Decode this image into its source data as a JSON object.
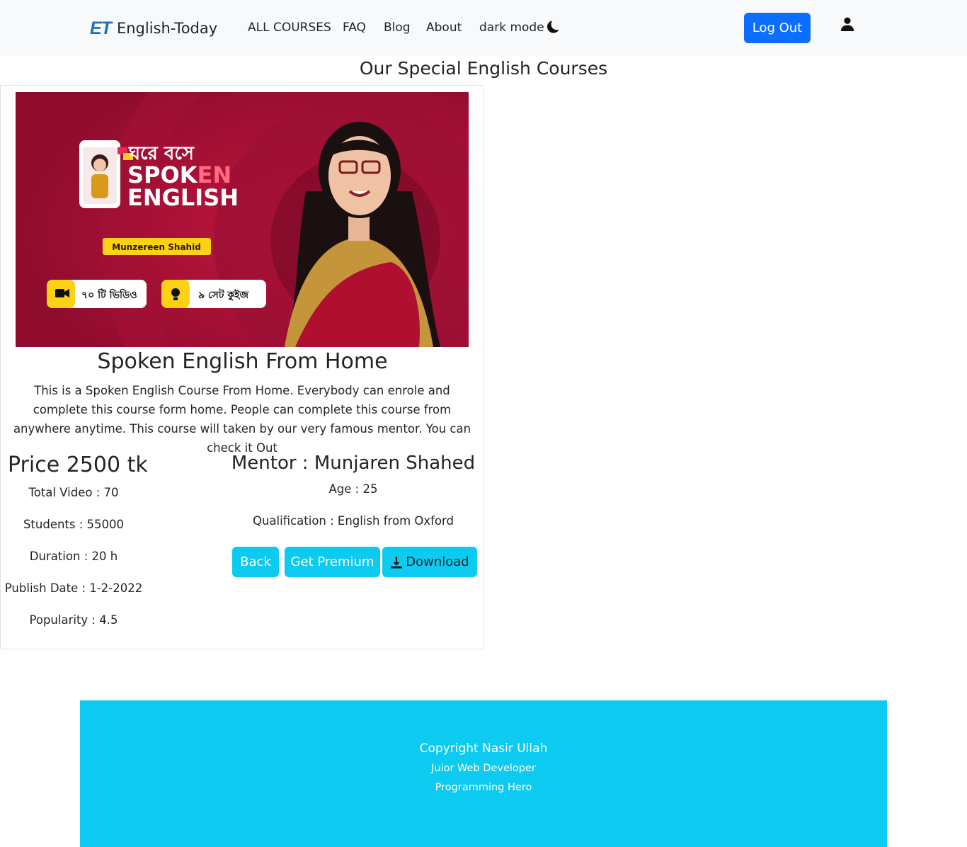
{
  "navbar": {
    "brand_logo": "ET",
    "brand_name": "English-Today",
    "links": [
      "ALL COURSES",
      "FAQ",
      "Blog",
      "About",
      "dark mode"
    ],
    "logout_label": "Log Out",
    "icons": {
      "dark_mode": "moon-icon",
      "user": "user-icon"
    },
    "colors": {
      "background": "#f8f9fa",
      "primary": "#0d6efd",
      "brand": "#1f6fb5"
    }
  },
  "page": {
    "title": "Our Special English Courses"
  },
  "course": {
    "banner": {
      "headline_bangla": "ঘরে বসে",
      "headline_line1_a": "SPOK",
      "headline_line1_b": "EN",
      "headline_line2": "ENGLISH",
      "mentor_tag": "Munzereen Shahid",
      "badge_video": "৭০ টি ভিডিও",
      "badge_quiz": "৯ সেট কুইজ",
      "colors": {
        "background": "#b5103a",
        "badge": "#fcd116"
      }
    },
    "title": "Spoken English From Home",
    "description": "This is a Spoken English Course From Home. Everybody can enrole and complete this course form home. People can complete this course from anywhere anytime. This course will taken by our very famous mentor. You can check it Out",
    "price": "Price 2500 tk",
    "stats": [
      "Total Video : 70",
      "Students : 55000",
      "Duration : 20 h",
      "Publish Date : 1-2-2022",
      "Popularity : 4.5"
    ],
    "mentor": "Mentor : Munjaren Shahed",
    "mentor_age": "Age : 25",
    "mentor_qualification": "Qualification : English from Oxford",
    "buttons": {
      "back": "Back",
      "premium": "Get Premium",
      "download": "Download"
    },
    "colors": {
      "button": "#0dcaf0"
    }
  },
  "footer": {
    "line1": "Copyright Nasir Ullah",
    "line2": "Juior Web Developer",
    "line3": "Programming Hero",
    "background": "#0dcaf0"
  }
}
